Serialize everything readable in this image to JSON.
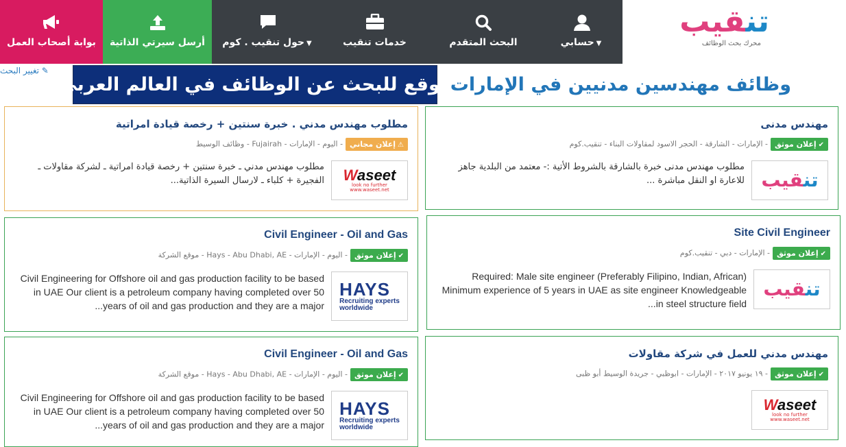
{
  "nav": {
    "employers": "بوابة أصحاب العمل",
    "send_cv": "أرسل سيرتي الذاتية",
    "about": "حول تنقيب . كوم",
    "services": "خدمات تنقيب",
    "advanced_search": "البحث المتقدم",
    "account": "حسابي"
  },
  "logo": {
    "word_main": "تن",
    "word_accent": "قيب",
    "tagline": "محرك بحث الوظائف"
  },
  "change_search": "تغيير البحث",
  "banner_text": "موقع للبحث عن الوظائف في العالم العربي",
  "page_title": "وظائف مهندسين مدنيين في الإمارات",
  "cards": [
    {
      "title": "مهندس مدنى",
      "badge": "إعلان موثق",
      "meta": "- الإمارات - الشارقة - الحجر الاسود لمقاولات البناء - تنقيب.كوم",
      "description": "مطلوب مهندس مدنى خبرة بالشارقة بالشروط الأتية :- معتمد من البلدية جاهز للاعارة او النقل مباشرة ...",
      "company_logo": "tanqeeb-logo"
    },
    {
      "title": "مطلوب مهندس مدني . خبرة سنتين + رخصة قيادة امراتية",
      "badge": "إعلان مجاني",
      "meta": "- اليوم - الإمارات - Fujairah - وظائف الوسيط",
      "description": "مطلوب مهندس مدني ـ خبرة سنتين + رخصة قيادة امراتية ـ لشركة مقاولات ـ الفجيرة + كلباء ـ لارسال السيرة الذاتية...",
      "company_logo": "waseet-logo"
    },
    {
      "title": "Site Civil Engineer",
      "badge": "إعلان موثق",
      "meta": "- الإمارات - دبي - تنقيب.كوم",
      "description": "Required: Male site engineer (Preferably Filipino, Indian, African) Minimum experience of 5 years in UAE as site engineer Knowledgeable in steel structure field...",
      "company_logo": "tanqeeb-logo"
    },
    {
      "title": "Civil Engineer - Oil and Gas",
      "badge": "إعلان موثق",
      "meta": "- اليوم - الإمارات - Hays - Abu Dhabi, AE - موقع الشركة",
      "description": "Civil Engineering for Offshore oil and gas production facility to be based in UAE Our client is a petroleum company having completed over 50 years of oil and gas production and they are a major...",
      "company_logo": "hays-logo"
    },
    {
      "title": "مهندس مدني للعمل في شركة مقاولات",
      "badge": "إعلان موثق",
      "meta": "- ١٩ يونيو ٢٠١٧ - الإمارات - ابوظبي - جريدة الوسيط أبو ظبى",
      "description": "",
      "company_logo": "waseet-logo"
    },
    {
      "title": "Civil Engineer - Oil and Gas",
      "badge": "إعلان موثق",
      "meta": "- اليوم - الإمارات - Hays - Abu Dhabi, AE - موقع الشركة",
      "description": "Civil Engineering for Offshore oil and gas production facility to be based in UAE Our client is a petroleum company having completed over 50 years of oil and gas production and they are a major...",
      "company_logo": "hays-logo"
    }
  ],
  "logos": {
    "tanqeeb_main": "تن",
    "tanqeeb_accent": "قيب",
    "waseet_word_a": "W",
    "waseet_word_b": "aseet",
    "waseet_slogan": "look no further",
    "waseet_url": "www.waseet.net",
    "hays_word": "HAYS",
    "hays_tagline_1": "Recruiting experts",
    "hays_tagline_2": "worldwide"
  },
  "colors": {
    "nav_bg": "#3a3f44",
    "employers_bg": "#d81b60",
    "cv_bg": "#3cad55",
    "verified_badge": "#3cab4d",
    "free_badge": "#f0ad4e",
    "title_blue": "#23487e",
    "banner_bg": "#0d2f7a"
  }
}
